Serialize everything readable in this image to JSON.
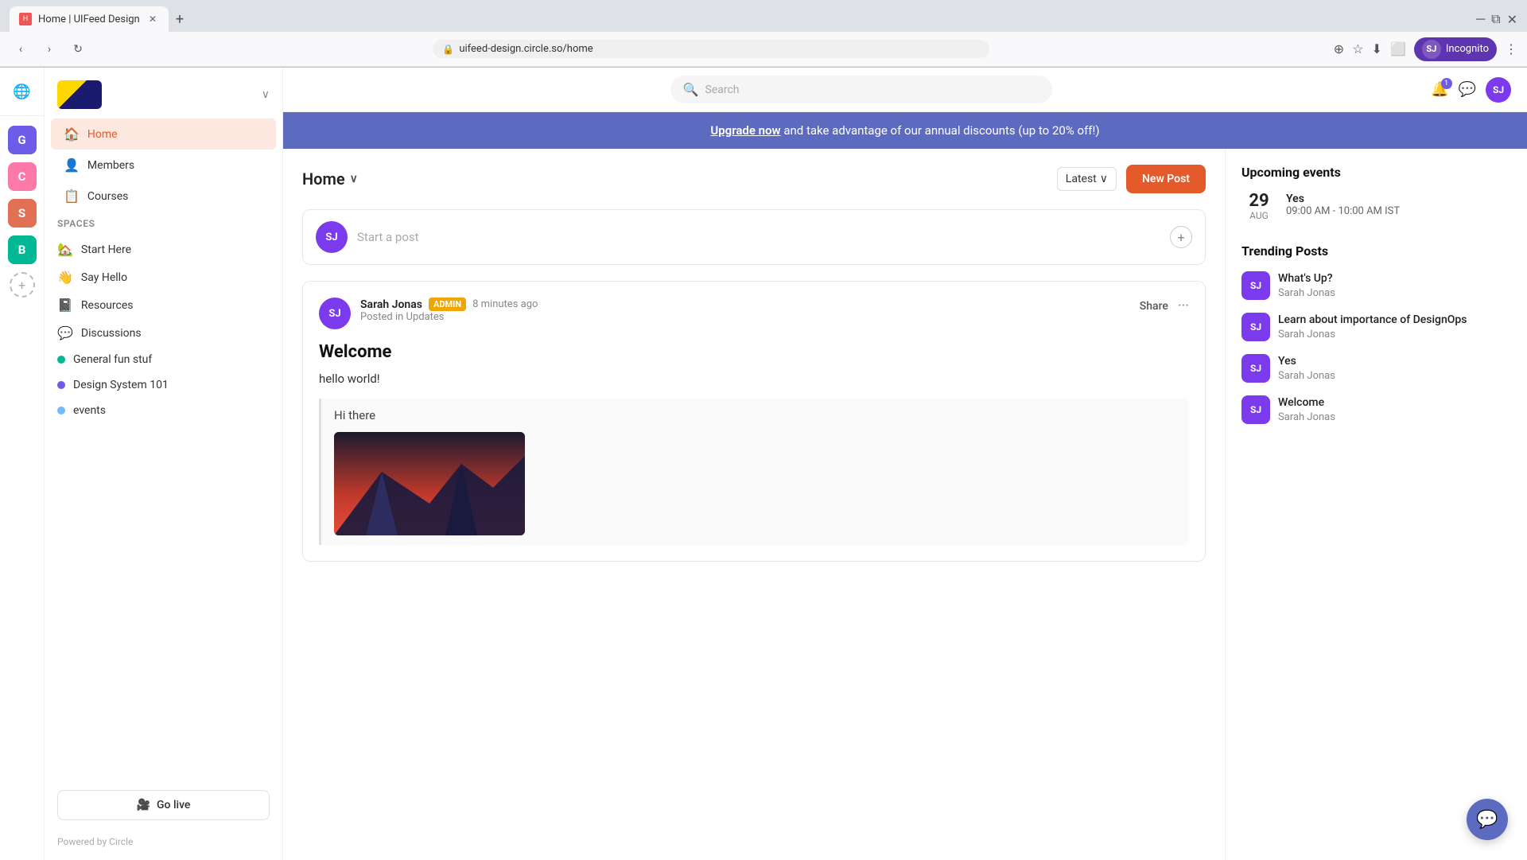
{
  "browser": {
    "tab_title": "Home | UIFeed Design",
    "tab_favicon": "H",
    "url": "uifeed-design.circle.so/home",
    "incognito_label": "Incognito",
    "incognito_avatar": "SJ",
    "new_tab_label": "+"
  },
  "search": {
    "placeholder": "Search"
  },
  "icon_sidebar": {
    "globe_icon": "🌐",
    "g_label": "G",
    "c_label": "C",
    "s_label": "S",
    "b_label": "B",
    "add_label": "+"
  },
  "left_nav": {
    "home_label": "Home",
    "members_label": "Members",
    "courses_label": "Courses",
    "spaces_label": "Spaces",
    "start_here_label": "Start Here",
    "say_hello_label": "Say Hello",
    "resources_label": "Resources",
    "discussions_label": "Discussions",
    "general_fun_label": "General fun stuf",
    "design_system_label": "Design System 101",
    "events_label": "events",
    "go_live_label": "Go live",
    "powered_by": "Powered by Circle"
  },
  "banner": {
    "upgrade_link": "Upgrade now",
    "text": " and take advantage of our annual discounts (up to 20% off!)"
  },
  "feed": {
    "title": "Home",
    "sort_label": "Latest",
    "new_post_label": "New Post",
    "compose_placeholder": "Start a post",
    "post": {
      "author": "Sarah Jonas",
      "admin_badge": "ADMIN",
      "time_ago": "8 minutes ago",
      "posted_in": "Posted in Updates",
      "share_label": "Share",
      "title": "Welcome",
      "body": "hello world!",
      "quote_text": "Hi there",
      "avatar_initials": "SJ"
    }
  },
  "right_sidebar": {
    "events_title": "Upcoming events",
    "event": {
      "day": "29",
      "month": "AUG",
      "title": "Yes",
      "time": "09:00 AM - 10:00 AM IST"
    },
    "trending_title": "Trending Posts",
    "trending_items": [
      {
        "title": "What's Up?",
        "author": "Sarah Jonas",
        "initials": "SJ"
      },
      {
        "title": "Learn about importance of DesignOps",
        "author": "Sarah Jonas",
        "initials": "SJ"
      },
      {
        "title": "Yes",
        "author": "Sarah Jonas",
        "initials": "SJ"
      },
      {
        "title": "Welcome",
        "author": "Sarah Jonas",
        "initials": "SJ"
      }
    ]
  },
  "notifications": {
    "count": "1"
  }
}
